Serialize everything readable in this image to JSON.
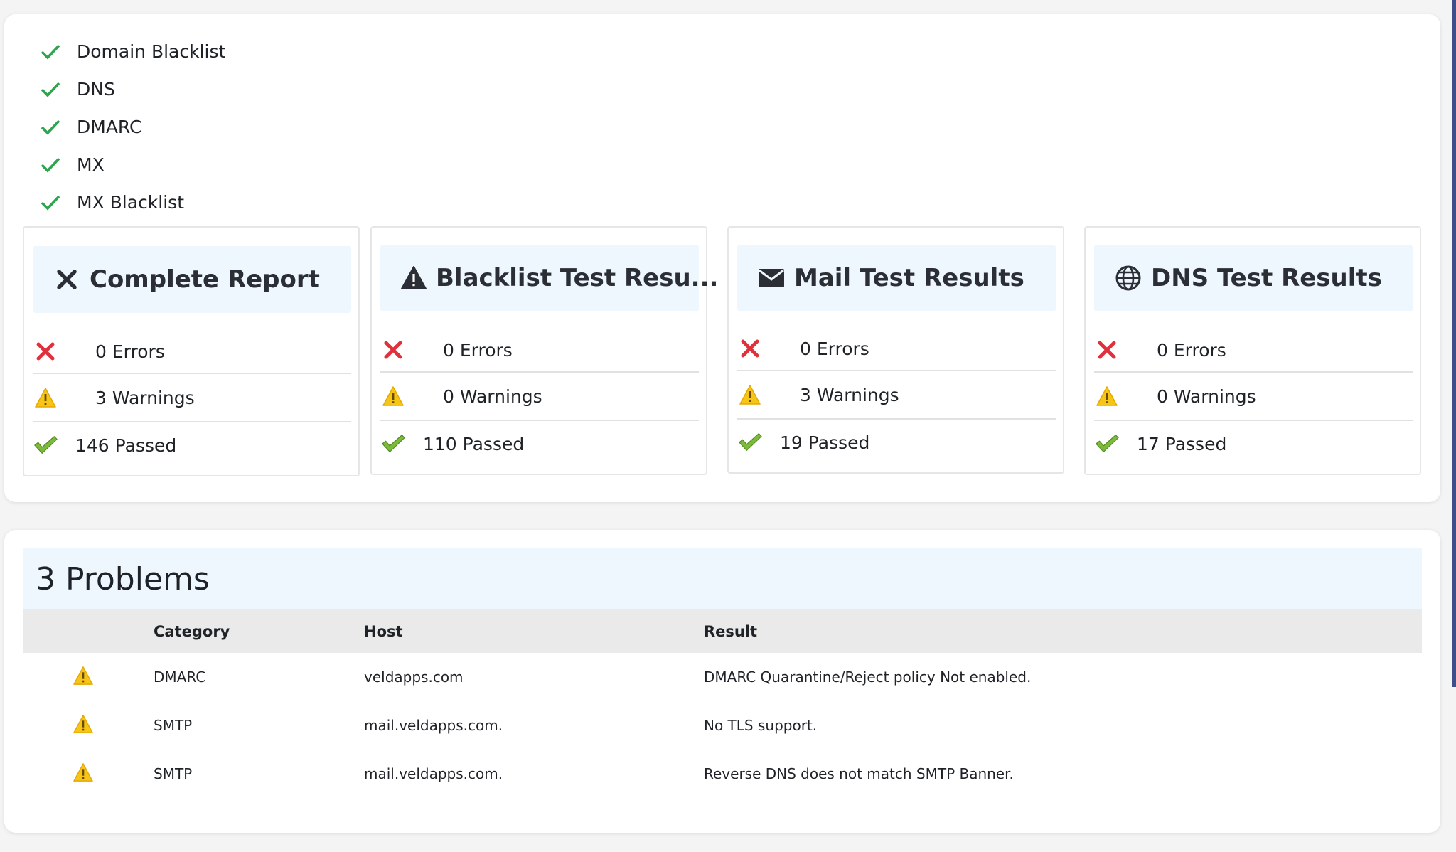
{
  "checklist": [
    {
      "label": "Domain Blacklist",
      "icon": "check-icon"
    },
    {
      "label": "DNS",
      "icon": "check-icon"
    },
    {
      "label": "DMARC",
      "icon": "check-icon"
    },
    {
      "label": "MX",
      "icon": "check-icon"
    },
    {
      "label": "MX Blacklist",
      "icon": "check-icon"
    }
  ],
  "cards": [
    {
      "title": "Complete Report",
      "icon": "x-icon",
      "errors": "0 Errors",
      "warnings": "3 Warnings",
      "passed": "146 Passed"
    },
    {
      "title": "Blacklist Test Resu...",
      "icon": "warning-icon",
      "errors": "0 Errors",
      "warnings": "0 Warnings",
      "passed": "110 Passed"
    },
    {
      "title": "Mail Test Results",
      "icon": "envelope-icon",
      "errors": "0 Errors",
      "warnings": "3 Warnings",
      "passed": "19 Passed"
    },
    {
      "title": "DNS Test Results",
      "icon": "globe-icon",
      "errors": "0 Errors",
      "warnings": "0 Warnings",
      "passed": "17 Passed"
    }
  ],
  "problems": {
    "title": "3 Problems",
    "columns": {
      "category": "Category",
      "host": "Host",
      "result": "Result"
    },
    "rows": [
      {
        "icon": "warning-icon",
        "category": "DMARC",
        "host": "veldapps.com",
        "result": "DMARC Quarantine/Reject policy Not enabled."
      },
      {
        "icon": "warning-icon",
        "category": "SMTP",
        "host": "mail.veldapps.com.",
        "result": "No TLS support."
      },
      {
        "icon": "warning-icon",
        "category": "SMTP",
        "host": "mail.veldapps.com.",
        "result": "Reverse DNS does not match SMTP Banner."
      }
    ]
  },
  "colors": {
    "check_green": "#2ea44f",
    "passed_green": "#7dba3c",
    "error_red": "#e0303c",
    "warning_yellow": "#f5c518",
    "header_bg": "#edf7fd",
    "table_header_bg": "#eaeaea",
    "scrollbar": "#3d4f86"
  }
}
